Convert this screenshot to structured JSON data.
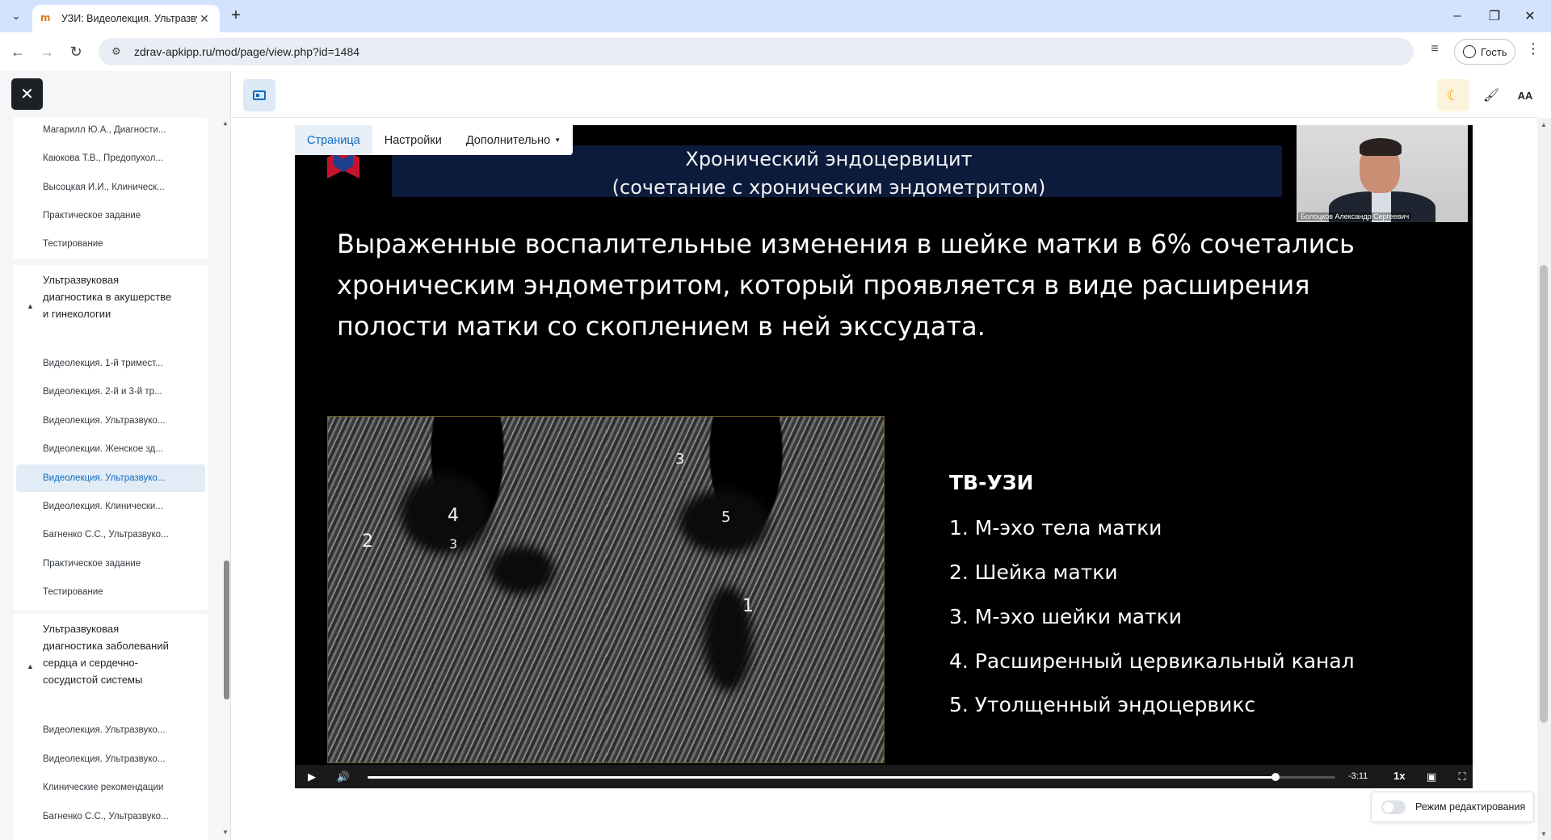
{
  "browser": {
    "tab_title": "УЗИ: Видеолекция. Ультразвук",
    "url": "zdrav-apkipp.ru/mod/page/view.php?id=1484",
    "profile_label": "Гость",
    "favicon_text": "m"
  },
  "drawer": {
    "group1_items": [
      "Магарилл Ю.А., Диагности...",
      "Каюкова Т.В., Предопухол...",
      "Высоцкая И.И., Клиническ...",
      "Практическое задание",
      "Тестирование"
    ],
    "section2_title": "Ультразвуковая диагностика в акушерстве и гинекологии",
    "group2_items": [
      "Видеолекция. 1-й тримест...",
      "Видеолекция. 2-й и 3-й тр...",
      "Видеолекция. Ультразвуко...",
      "Видеолекции. Женское зд...",
      "Видеолекция. Ультразвуко...",
      "Видеолекция. Клинически...",
      "Багненко С.С., Ультразвуко...",
      "Практическое задание",
      "Тестирование"
    ],
    "active_index_group2": 4,
    "section3_title": "Ультразвуковая диагностика заболеваний сердца и сердечно-сосудистой системы",
    "group3_items": [
      "Видеолекция. Ультразвуко...",
      "Видеолекция. Ультразвуко...",
      "Клинические рекомендации",
      "Багненко С.С., Ультразвуко..."
    ]
  },
  "header": {
    "font_size_label": "AA"
  },
  "secondary_nav": {
    "page": "Страница",
    "settings": "Настройки",
    "more": "Дополнительно"
  },
  "slide": {
    "title_line1": "Хронический эндоцервицит",
    "title_line2": "(сочетание с хроническим эндометритом)",
    "presenter_name": "Болоцков Александр Сергеевич",
    "body_line1": "Выраженные воспалительные изменения в шейке матки в 6% сочетались",
    "body_line2": "хроническим эндометритом, который проявляется в виде расширения",
    "body_line3": "полости матки со скоплением в ней экссудата.",
    "legend_title": "ТВ-УЗИ",
    "legend": [
      "1. М-эхо тела матки",
      "2. Шейка матки",
      "3. М-эхо шейки матки",
      "4. Расширенный цервикальный канал",
      "5. Утолщенный эндоцервикс"
    ],
    "image_markers": [
      "4",
      "3",
      "2",
      "3",
      "5",
      "1"
    ]
  },
  "video": {
    "time_remaining": "-3:11",
    "speed": "1x",
    "progress": 0.938
  },
  "edit_mode": {
    "label": "Режим редактирования",
    "enabled": false
  },
  "colors": {
    "accent": "#0f6cbf",
    "slide_banner": "#0c1b3c",
    "chrome_tabbar": "#d3e3fd"
  }
}
